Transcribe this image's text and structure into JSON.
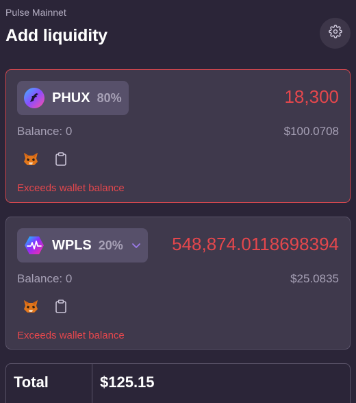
{
  "header": {
    "network": "Pulse Mainnet",
    "title": "Add liquidity",
    "settings_icon": "gear-icon"
  },
  "tokens": [
    {
      "symbol": "PHUX",
      "weight": "80%",
      "amount": "18,300",
      "balance": "Balance: 0",
      "usd_value": "$100.0708",
      "error": "Exceeds wallet balance",
      "logo_icon": "phux-logo-icon",
      "has_dropdown": false
    },
    {
      "symbol": "WPLS",
      "weight": "20%",
      "amount": "548,874.0118698394",
      "balance": "Balance: 0",
      "usd_value": "$25.0835",
      "error": "Exceeds wallet balance",
      "logo_icon": "wpls-logo-icon",
      "has_dropdown": true
    }
  ],
  "total": {
    "label": "Total",
    "value": "$125.15"
  },
  "colors": {
    "background": "#2b2538",
    "card": "#3f394c",
    "error": "#e5474c",
    "muted_text": "#a7a1b6"
  }
}
